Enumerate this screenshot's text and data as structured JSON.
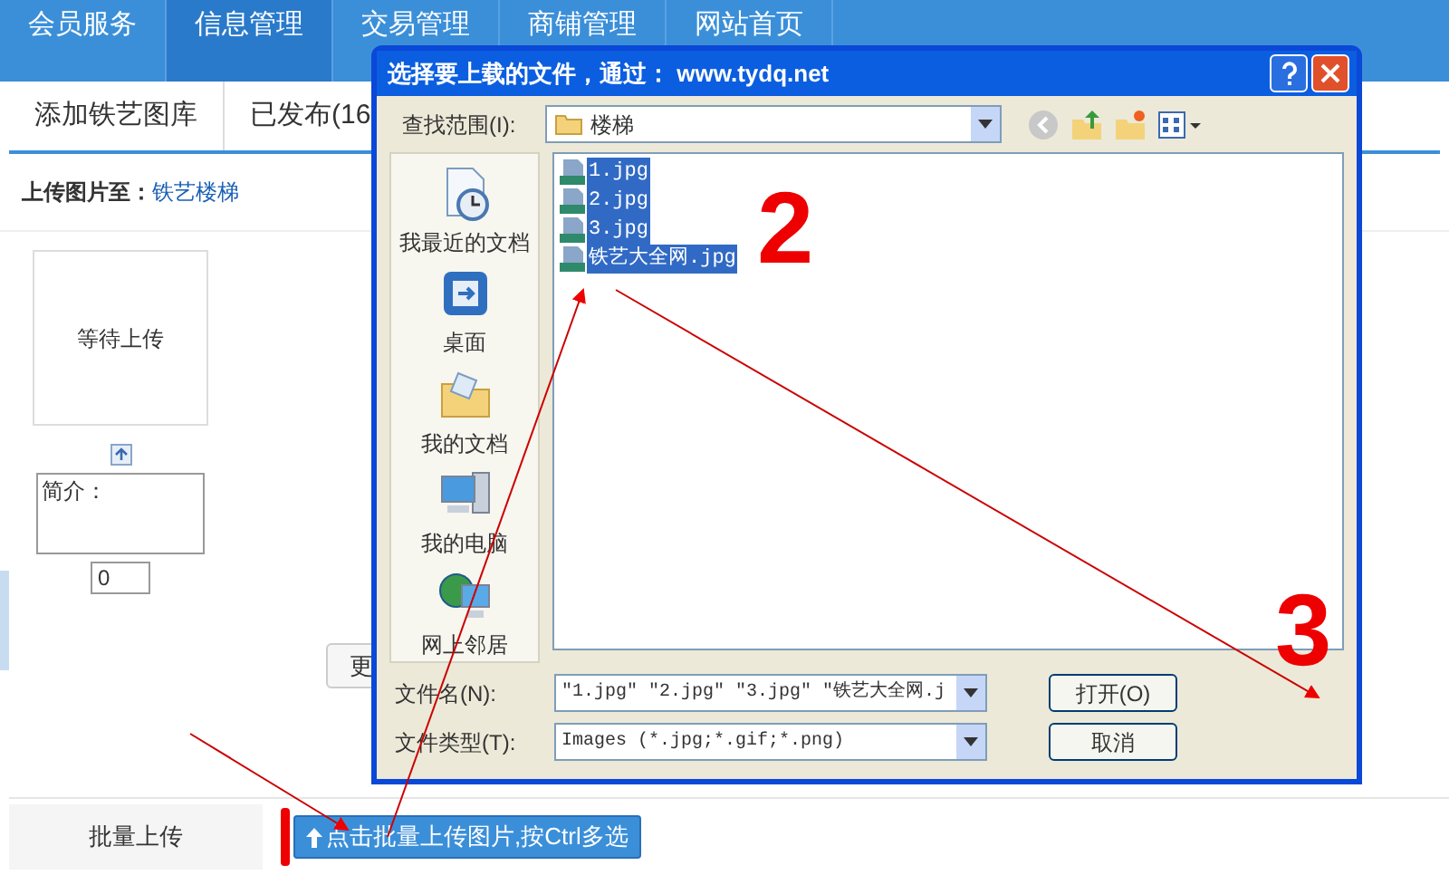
{
  "nav": {
    "tabs": [
      {
        "label": "会员服务",
        "selected": false
      },
      {
        "label": "信息管理",
        "selected": true
      },
      {
        "label": "交易管理",
        "selected": false
      },
      {
        "label": "商铺管理",
        "selected": false
      },
      {
        "label": "网站首页",
        "selected": false
      }
    ]
  },
  "subnav": {
    "tabs": [
      "添加铁艺图库",
      "已发布(16"
    ]
  },
  "upload_target": {
    "label": "上传图片至：",
    "link": "铁艺楼梯"
  },
  "preview": {
    "status": "等待上传"
  },
  "caption": {
    "value": "简介："
  },
  "order": {
    "value": "0"
  },
  "partial_button": "更",
  "batch": {
    "label": "批量上传",
    "button": "点击批量上传图片,按Ctrl多选"
  },
  "dialog": {
    "title": "选择要上载的文件，通过： www.tydq.net",
    "look_in_label": "查找范围(I):",
    "look_in_value": "楼梯",
    "places": [
      {
        "label": "我最近的文档",
        "kind": "recent"
      },
      {
        "label": "桌面",
        "kind": "desktop"
      },
      {
        "label": "我的文档",
        "kind": "documents"
      },
      {
        "label": "我的电脑",
        "kind": "computer"
      },
      {
        "label": "网上邻居",
        "kind": "network"
      }
    ],
    "files": [
      {
        "name": "1.jpg",
        "selected": true
      },
      {
        "name": "2.jpg",
        "selected": true
      },
      {
        "name": "3.jpg",
        "selected": true
      },
      {
        "name": "铁艺大全网.jpg",
        "selected": true
      }
    ],
    "filename_label": "文件名(N):",
    "filename_value": "\"1.jpg\" \"2.jpg\" \"3.jpg\" \"铁艺大全网.j",
    "filetype_label": "文件类型(T):",
    "filetype_value": "Images (*.jpg;*.gif;*.png)",
    "buttons": [
      "打开(O)",
      "取消"
    ]
  },
  "annotations": [
    {
      "kind": "number",
      "text": "2"
    },
    {
      "kind": "number",
      "text": "3"
    }
  ]
}
